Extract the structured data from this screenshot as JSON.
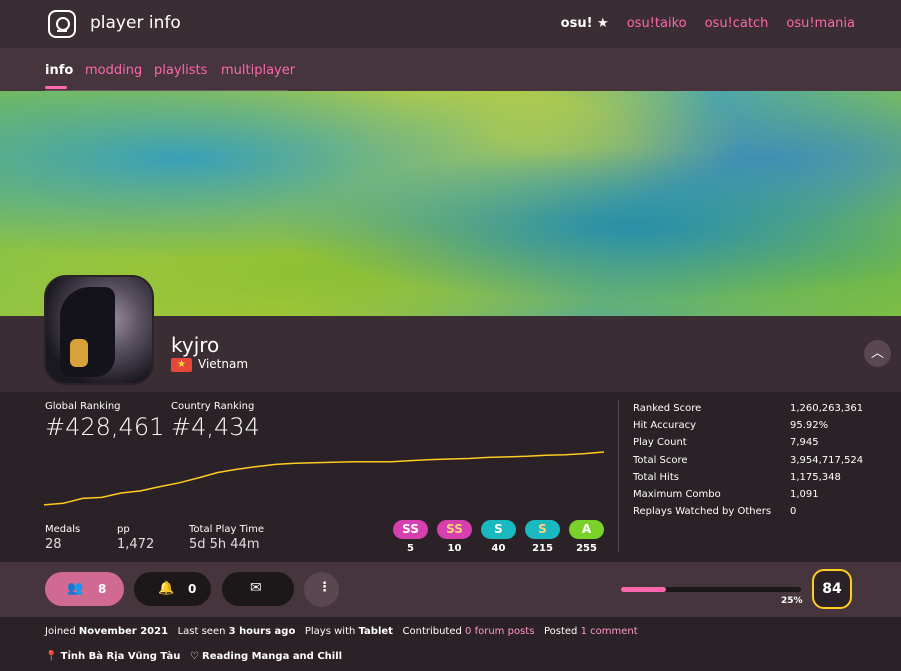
{
  "header": {
    "title": "player info"
  },
  "modes": [
    "osu!",
    "osu!taiko",
    "osu!catch",
    "osu!mania"
  ],
  "tabs": [
    "info",
    "modding",
    "playlists",
    "multiplayer"
  ],
  "profile": {
    "username": "kyjro",
    "country": "Vietnam"
  },
  "ranking": {
    "global_label": "Global Ranking",
    "global_value": "#428,461",
    "country_label": "Country Ranking",
    "country_value": "#4,434"
  },
  "summary": {
    "medals_label": "Medals",
    "medals_value": "28",
    "pp_label": "pp",
    "pp_value": "1,472",
    "playtime_label": "Total Play Time",
    "playtime_value": "5d 5h 44m"
  },
  "grades": [
    {
      "label": "SS",
      "count": "5",
      "color": "#d63fae",
      "text_color": "#ffffff"
    },
    {
      "label": "SS",
      "count": "10",
      "color": "#d63fae",
      "text_color": "#ffd37a"
    },
    {
      "label": "S",
      "count": "40",
      "color": "#1ab8bf",
      "text_color": "#ffffff"
    },
    {
      "label": "S",
      "count": "215",
      "color": "#1ab8bf",
      "text_color": "#ffd37a"
    },
    {
      "label": "A",
      "count": "255",
      "color": "#7ad12a",
      "text_color": "#ffffff"
    }
  ],
  "stats": [
    {
      "label": "Ranked Score",
      "value": "1,260,263,361"
    },
    {
      "label": "Hit Accuracy",
      "value": "95.92%"
    },
    {
      "label": "Play Count",
      "value": "7,945"
    },
    {
      "label": "Total Score",
      "value": "3,954,717,524"
    },
    {
      "label": "Total Hits",
      "value": "1,175,348"
    },
    {
      "label": "Maximum Combo",
      "value": "1,091"
    },
    {
      "label": "Replays Watched by Others",
      "value": "0"
    }
  ],
  "actions": {
    "friends": "8",
    "notifications": "0"
  },
  "level": {
    "value": "84",
    "progress_text": "25%",
    "progress": 0.25
  },
  "rank_history": [
    0.02,
    0.05,
    0.14,
    0.16,
    0.24,
    0.28,
    0.36,
    0.43,
    0.52,
    0.62,
    0.68,
    0.73,
    0.77,
    0.79,
    0.8,
    0.81,
    0.82,
    0.82,
    0.82,
    0.84,
    0.86,
    0.87,
    0.88,
    0.9,
    0.91,
    0.92,
    0.94,
    0.95,
    0.97,
    1.0
  ],
  "footer": {
    "joined_prefix": "Joined ",
    "joined_value": "November 2021",
    "seen_prefix": "Last seen ",
    "seen_value": "3 hours ago",
    "plays_prefix": "Plays with ",
    "plays_value": "Tablet",
    "contrib_prefix": "Contributed ",
    "contrib_value": "0 forum posts",
    "posted_prefix": "Posted ",
    "posted_value": "1 comment",
    "location": "Tỉnh Bà Rịa Vũng Tàu",
    "interests": "Reading Manga and Chill"
  },
  "colors": {
    "accent": "#ff66ab",
    "level_border": "#ffcc22",
    "graph_line": "#ffcc22"
  }
}
